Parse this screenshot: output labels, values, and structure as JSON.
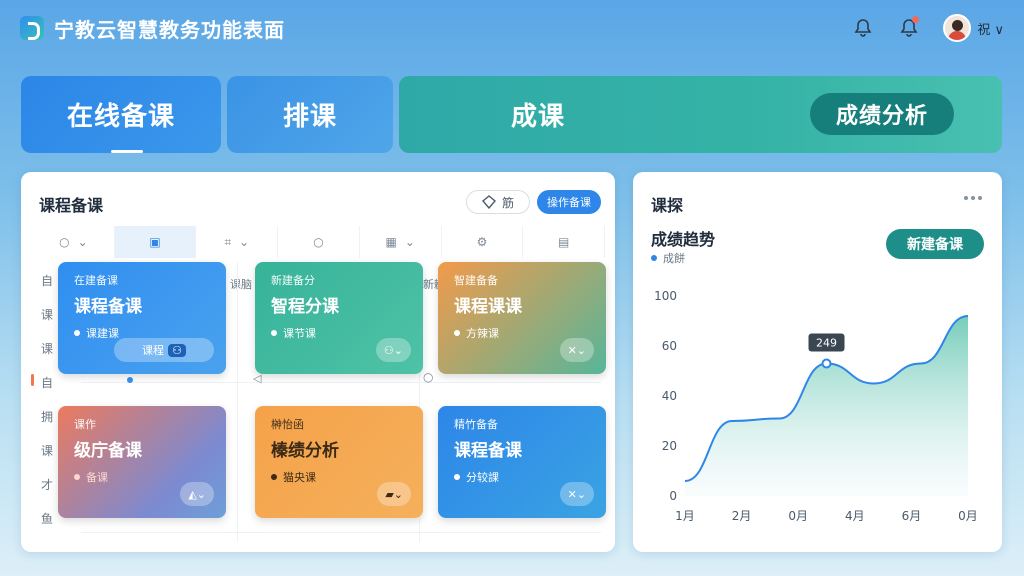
{
  "header": {
    "app_title": "宁教云智慧教务功能表面",
    "user_name": "祝 ∨"
  },
  "tabs": [
    {
      "label": "在线备课"
    },
    {
      "label": "排课"
    },
    {
      "label": "成课"
    },
    {
      "label": "成绩分析"
    }
  ],
  "left_panel": {
    "title": "课程备课",
    "filter_label": "筋",
    "action_label": "操作备课",
    "side_labels": [
      "自",
      "课",
      "课",
      "自",
      "拥",
      "课",
      "才",
      "鱼"
    ],
    "row_label_1": "课脑",
    "row_label_2": "新鶒",
    "cards": [
      {
        "sub": "在建备课",
        "title": "课程备课",
        "meta": "课建课",
        "btn": "课程"
      },
      {
        "sub": "新建备分",
        "title": "智程分课",
        "meta": "课节课",
        "btn": ""
      },
      {
        "sub": "智建备备",
        "title": "课程课课",
        "meta": "方辣课",
        "btn": ""
      },
      {
        "sub": "课作",
        "title": "级庁备课",
        "meta": "备课",
        "btn": ""
      },
      {
        "sub": "榊怡函",
        "title": "榛绩分析",
        "meta": "猫央课",
        "btn": ""
      },
      {
        "sub": "精竹备备",
        "title": "课程备课",
        "meta": "分较課",
        "btn": ""
      }
    ]
  },
  "right_panel": {
    "title": "课探",
    "chart_title": "成绩趋势",
    "legend_label": "成餅",
    "new_button": "新建备课",
    "tooltip": "249"
  },
  "chart_data": {
    "type": "area",
    "categories": [
      "1月",
      "2月",
      "0月",
      "4月",
      "6月",
      "0月"
    ],
    "yticks": [
      0,
      20,
      40,
      60,
      100
    ],
    "series": [
      {
        "values": [
          6,
          30,
          31,
          53,
          45,
          53,
          72
        ]
      }
    ],
    "ylim": [
      0,
      80
    ],
    "colors": {
      "line": "#2d86e8",
      "fill_top": "#5ec4ad",
      "fill_bottom": "#eaf6f9"
    }
  },
  "colors": {
    "primary": "#2d86e8",
    "teal": "#1e8f88"
  }
}
